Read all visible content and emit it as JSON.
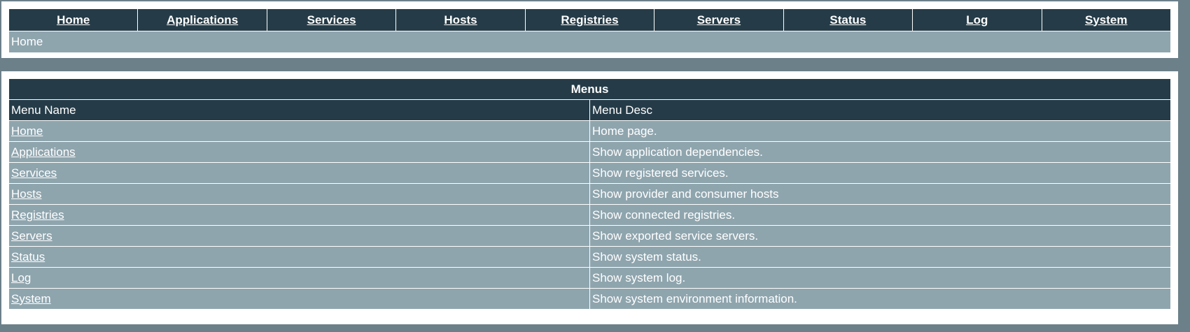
{
  "nav": {
    "items": [
      {
        "label": "Home"
      },
      {
        "label": "Applications"
      },
      {
        "label": "Services"
      },
      {
        "label": "Hosts"
      },
      {
        "label": "Registries"
      },
      {
        "label": "Servers"
      },
      {
        "label": "Status"
      },
      {
        "label": "Log"
      },
      {
        "label": "System"
      }
    ],
    "breadcrumb": "Home"
  },
  "menus": {
    "title": "Menus",
    "headers": {
      "name": "Menu Name",
      "desc": "Menu Desc"
    },
    "rows": [
      {
        "name": "Home",
        "desc": "Home page."
      },
      {
        "name": "Applications",
        "desc": "Show application dependencies."
      },
      {
        "name": "Services",
        "desc": "Show registered services."
      },
      {
        "name": "Hosts",
        "desc": "Show provider and consumer hosts"
      },
      {
        "name": "Registries",
        "desc": "Show connected registries."
      },
      {
        "name": "Servers",
        "desc": "Show exported service servers."
      },
      {
        "name": "Status",
        "desc": "Show system status."
      },
      {
        "name": "Log",
        "desc": "Show system log."
      },
      {
        "name": "System",
        "desc": "Show system environment information."
      }
    ]
  },
  "colors": {
    "header_bg": "#253c48",
    "row_bg": "#8fa5ae",
    "page_bg": "#6c8089"
  }
}
